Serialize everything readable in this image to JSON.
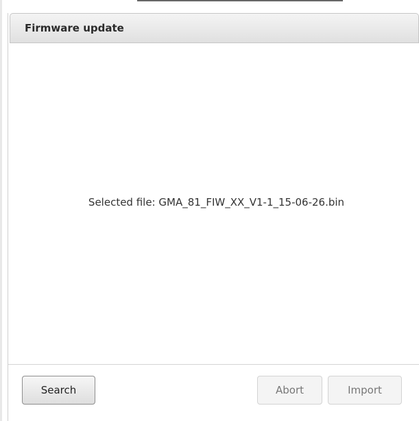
{
  "dialog": {
    "title": "Firmware update"
  },
  "content": {
    "selected_file_label": "Selected file:",
    "selected_file_name": "GMA_81_FIW_XX_V1-1_15-06-26.bin"
  },
  "footer": {
    "search_label": "Search",
    "abort_label": "Abort",
    "import_label": "Import",
    "abort_enabled": false,
    "import_enabled": false
  },
  "colors": {
    "header_bg": "#e6e6e6",
    "disabled_text": "#777777",
    "text": "#333333"
  }
}
